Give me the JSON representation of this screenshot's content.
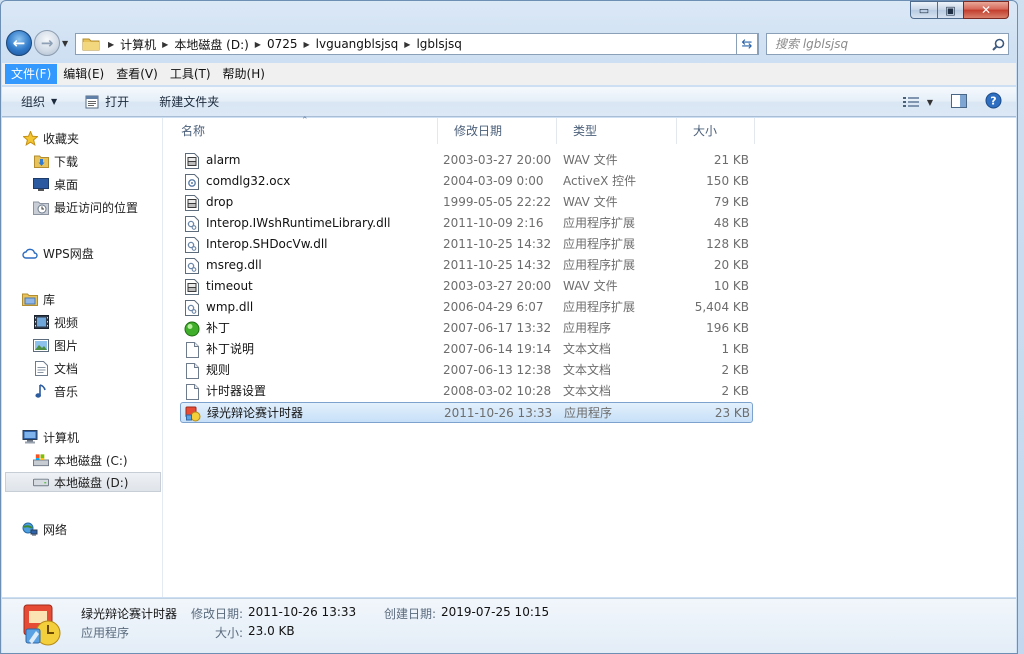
{
  "window": {
    "controls": {
      "minimize": "▭",
      "maximize": "▣",
      "close": "✕"
    }
  },
  "address": {
    "crumbs": [
      "计算机",
      "本地磁盘 (D:)",
      "0725",
      "lvguangblsjsq",
      "lgblsjsq"
    ]
  },
  "search": {
    "placeholder": "搜索 lgblsjsq"
  },
  "menubar": [
    "文件(F)",
    "编辑(E)",
    "查看(V)",
    "工具(T)",
    "帮助(H)"
  ],
  "toolbar": {
    "organize": "组织",
    "open": "打开",
    "new_folder": "新建文件夹"
  },
  "sidebar": {
    "favorites": "收藏夹",
    "downloads": "下载",
    "desktop": "桌面",
    "recent": "最近访问的位置",
    "wps": "WPS网盘",
    "libraries": "库",
    "videos": "视频",
    "pictures": "图片",
    "documents": "文档",
    "music": "音乐",
    "computer": "计算机",
    "drive_c": "本地磁盘 (C:)",
    "drive_d": "本地磁盘 (D:)",
    "network": "网络"
  },
  "columns": {
    "name": "名称",
    "date": "修改日期",
    "type": "类型",
    "size": "大小"
  },
  "files": [
    {
      "name": "alarm",
      "date": "2003-03-27 20:00",
      "type": "WAV 文件",
      "size": "21 KB",
      "icon": "wav-icon"
    },
    {
      "name": "comdlg32.ocx",
      "date": "2004-03-09 0:00",
      "type": "ActiveX 控件",
      "size": "150 KB",
      "icon": "ocx-icon"
    },
    {
      "name": "drop",
      "date": "1999-05-05 22:22",
      "type": "WAV 文件",
      "size": "79 KB",
      "icon": "wav-icon"
    },
    {
      "name": "Interop.IWshRuntimeLibrary.dll",
      "date": "2011-10-09 2:16",
      "type": "应用程序扩展",
      "size": "48 KB",
      "icon": "dll-icon"
    },
    {
      "name": "Interop.SHDocVw.dll",
      "date": "2011-10-25 14:32",
      "type": "应用程序扩展",
      "size": "128 KB",
      "icon": "dll-icon"
    },
    {
      "name": "msreg.dll",
      "date": "2011-10-25 14:32",
      "type": "应用程序扩展",
      "size": "20 KB",
      "icon": "dll-icon"
    },
    {
      "name": "timeout",
      "date": "2003-03-27 20:00",
      "type": "WAV 文件",
      "size": "10 KB",
      "icon": "wav-icon"
    },
    {
      "name": "wmp.dll",
      "date": "2006-04-29 6:07",
      "type": "应用程序扩展",
      "size": "5,404 KB",
      "icon": "dll-icon"
    },
    {
      "name": "补丁",
      "date": "2007-06-17 13:32",
      "type": "应用程序",
      "size": "196 KB",
      "icon": "green-app-icon"
    },
    {
      "name": "补丁说明",
      "date": "2007-06-14 19:14",
      "type": "文本文档",
      "size": "1 KB",
      "icon": "text-file-icon"
    },
    {
      "name": "规则",
      "date": "2007-06-13 12:38",
      "type": "文本文档",
      "size": "2 KB",
      "icon": "text-file-icon"
    },
    {
      "name": "计时器设置",
      "date": "2008-03-02 10:28",
      "type": "文本文档",
      "size": "2 KB",
      "icon": "text-file-icon"
    },
    {
      "name": "绿光辩论赛计时器",
      "date": "2011-10-26 13:33",
      "type": "应用程序",
      "size": "23 KB",
      "icon": "timer-app-icon"
    }
  ],
  "details": {
    "name": "绿光辩论赛计时器",
    "type": "应用程序",
    "modified_label": "修改日期:",
    "modified": "2011-10-26 13:33",
    "created_label": "创建日期:",
    "created": "2019-07-25 10:15",
    "size_label": "大小:",
    "size": "23.0 KB"
  },
  "colors": {
    "accent": "#3399ff",
    "selection": "#c7e0f8",
    "window_frame": "#cddff2"
  }
}
